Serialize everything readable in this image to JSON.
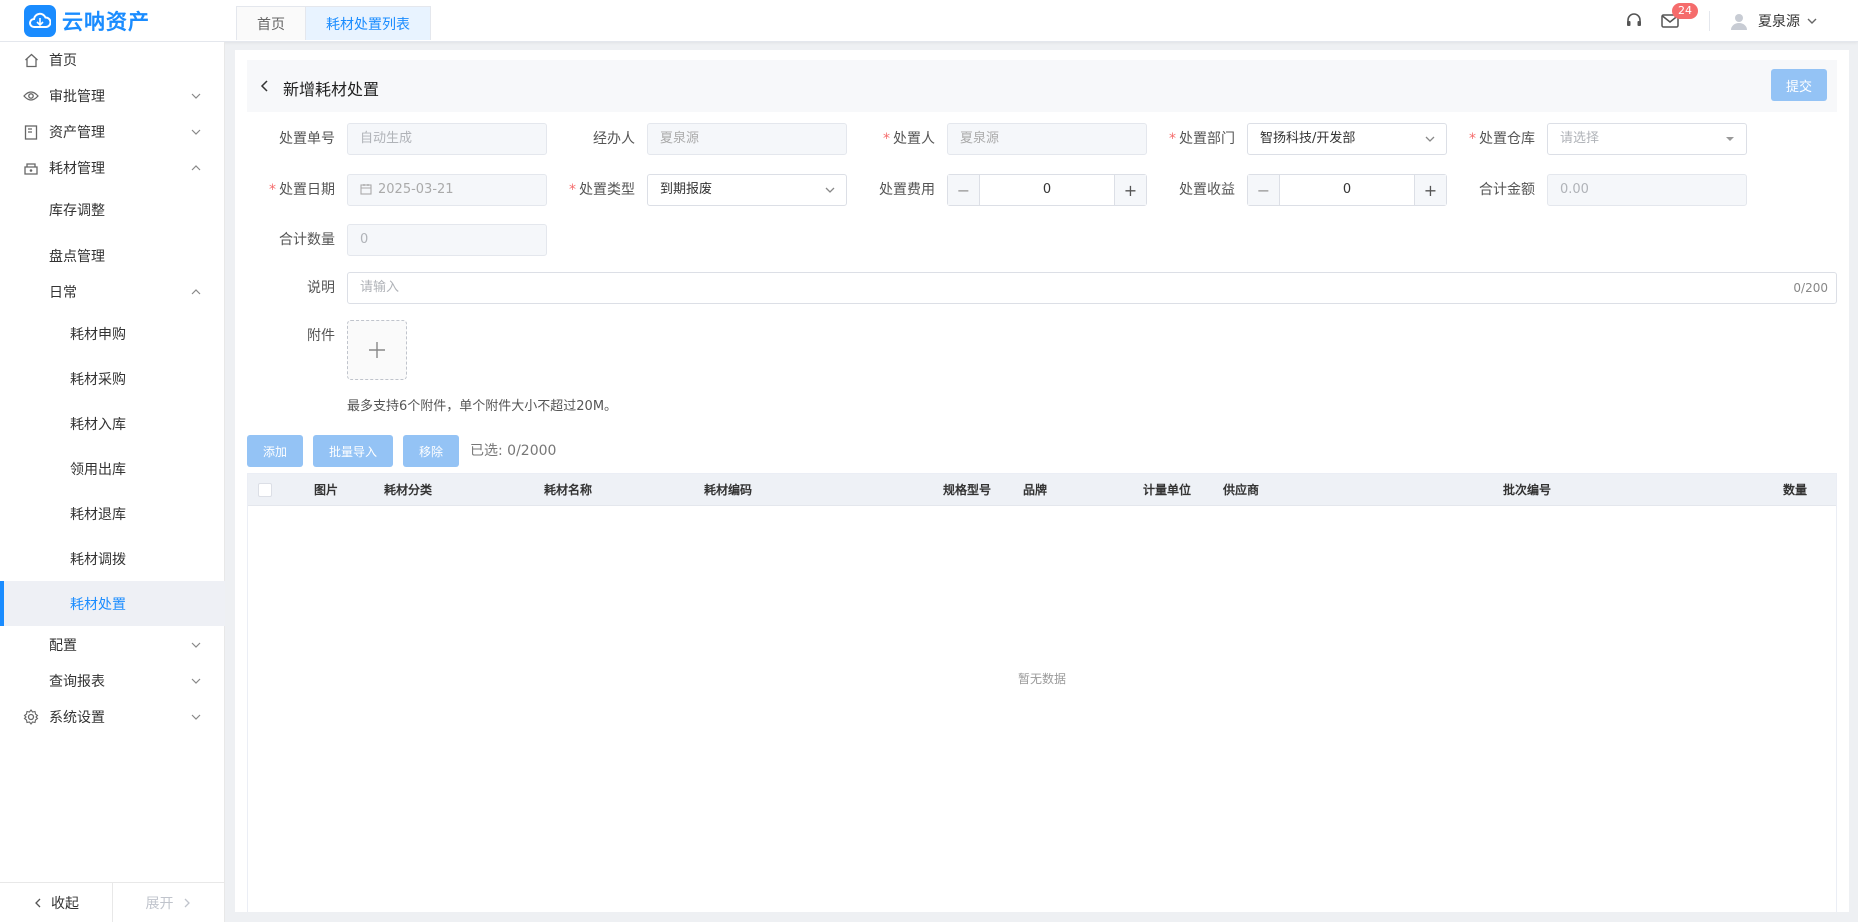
{
  "app": {
    "logo_text": "云呐资产"
  },
  "tabs": [
    {
      "label": "首页",
      "active": false
    },
    {
      "label": "耗材处置列表",
      "active": true
    }
  ],
  "header": {
    "message_count": "24",
    "username": "夏泉源"
  },
  "sidebar": {
    "items": [
      {
        "label": "首页",
        "icon": "home-icon",
        "level": 1
      },
      {
        "label": "审批管理",
        "icon": "eye-icon",
        "level": 1,
        "arrow": "down"
      },
      {
        "label": "资产管理",
        "icon": "asset-icon",
        "level": 1,
        "arrow": "down"
      },
      {
        "label": "耗材管理",
        "icon": "supplies-icon",
        "level": 1,
        "arrow": "up"
      },
      {
        "label": "库存调整",
        "level": 2
      },
      {
        "label": "盘点管理",
        "level": 2
      },
      {
        "label": "日常",
        "level": 2,
        "arrow": "up"
      },
      {
        "label": "耗材申购",
        "level": 3
      },
      {
        "label": "耗材采购",
        "level": 3
      },
      {
        "label": "耗材入库",
        "level": 3
      },
      {
        "label": "领用出库",
        "level": 3
      },
      {
        "label": "耗材退库",
        "level": 3
      },
      {
        "label": "耗材调拨",
        "level": 3
      },
      {
        "label": "耗材处置",
        "level": 3,
        "active": true
      },
      {
        "label": "配置",
        "level": 2,
        "arrow": "down"
      },
      {
        "label": "查询报表",
        "level": 2,
        "arrow": "down"
      },
      {
        "label": "系统设置",
        "icon": "settings-icon",
        "level": 1,
        "arrow": "down"
      }
    ],
    "collapse_label": "收起",
    "expand_label": "展开"
  },
  "page": {
    "title": "新增耗材处置",
    "submit_label": "提交"
  },
  "form": {
    "disposal_no": {
      "label": "处置单号",
      "placeholder": "自动生成"
    },
    "handler": {
      "label": "经办人",
      "value": "夏泉源"
    },
    "disposer": {
      "label": "处置人",
      "value": "夏泉源"
    },
    "department": {
      "label": "处置部门",
      "value": "智扬科技/开发部"
    },
    "warehouse": {
      "label": "处置仓库",
      "placeholder": "请选择"
    },
    "date": {
      "label": "处置日期",
      "value": "2025-03-21"
    },
    "type": {
      "label": "处置类型",
      "value": "到期报废"
    },
    "cost": {
      "label": "处置费用",
      "value": "0"
    },
    "income": {
      "label": "处置收益",
      "value": "0"
    },
    "total_amount": {
      "label": "合计金额",
      "placeholder": "0.00"
    },
    "total_qty": {
      "label": "合计数量",
      "placeholder": "0"
    },
    "remark": {
      "label": "说明",
      "placeholder": "请输入",
      "count": "0/200"
    },
    "attachment": {
      "label": "附件",
      "hint": "最多支持6个附件，单个附件大小不超过20M。"
    }
  },
  "actions": {
    "add_label": "添加",
    "import_label": "批量导入",
    "remove_label": "移除",
    "selected_text": "已选: 0/2000"
  },
  "table": {
    "columns": [
      "图片",
      "耗材分类",
      "耗材名称",
      "耗材编码",
      "规格型号",
      "品牌",
      "计量单位",
      "供应商",
      "批次编号",
      "数量"
    ],
    "empty_text": "暂无数据"
  },
  "colors": {
    "primary": "#1a8cff",
    "disabled_button": "#94c3f5",
    "required": "#f56c6c",
    "badge": "#f56c6c"
  }
}
